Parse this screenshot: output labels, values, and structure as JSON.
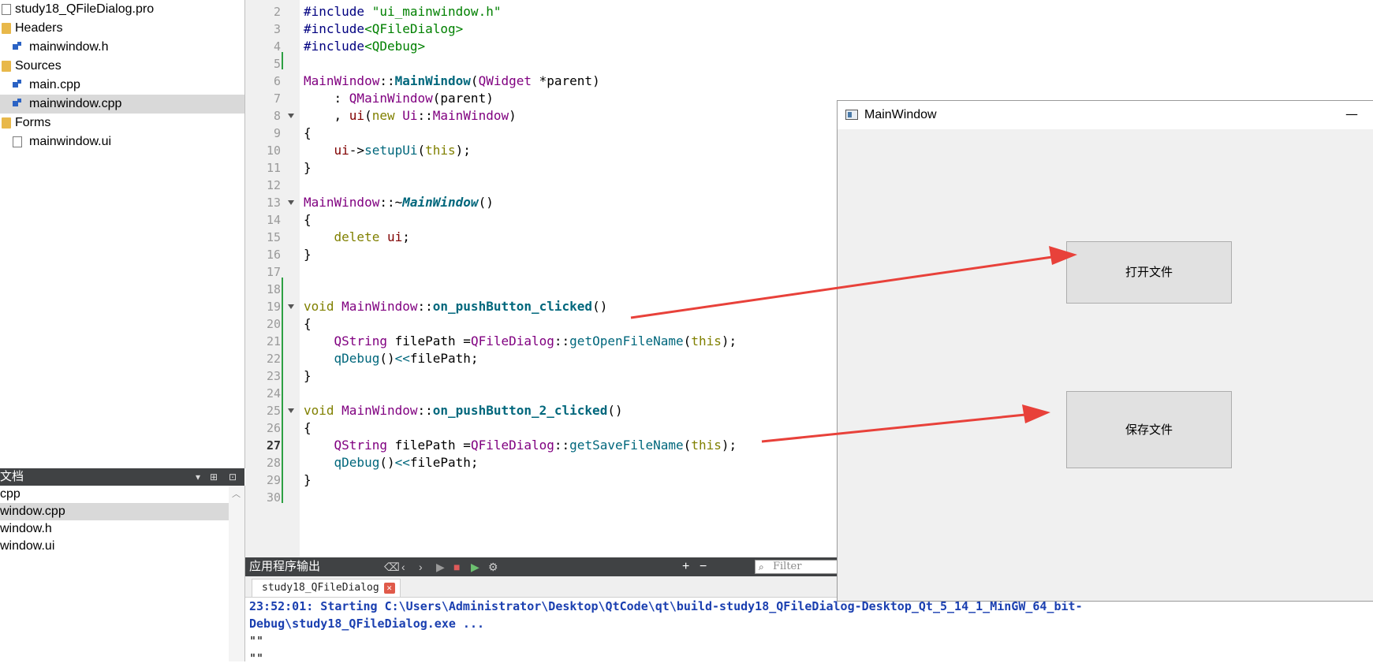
{
  "project_tree": [
    {
      "label": "study18_QFileDialog.pro",
      "indent": 0,
      "icon": "project-file-icon",
      "selected": false
    },
    {
      "label": "Headers",
      "indent": 0,
      "icon": "folder-icon",
      "selected": false
    },
    {
      "label": "mainwindow.h",
      "indent": 1,
      "icon": "header-file-icon",
      "selected": false
    },
    {
      "label": "Sources",
      "indent": 0,
      "icon": "folder-icon",
      "selected": false
    },
    {
      "label": "main.cpp",
      "indent": 1,
      "icon": "cpp-file-icon",
      "selected": false
    },
    {
      "label": "mainwindow.cpp",
      "indent": 1,
      "icon": "cpp-file-icon",
      "selected": true
    },
    {
      "label": "Forms",
      "indent": 0,
      "icon": "folder-icon",
      "selected": false
    },
    {
      "label": "mainwindow.ui",
      "indent": 1,
      "icon": "ui-file-icon",
      "selected": false
    }
  ],
  "open_docs": {
    "title": "文档",
    "items": [
      {
        "label": "cpp",
        "selected": false
      },
      {
        "label": "window.cpp",
        "selected": true
      },
      {
        "label": "window.h",
        "selected": false
      },
      {
        "label": "window.ui",
        "selected": false
      }
    ]
  },
  "editor": {
    "current_line": 27,
    "lines": [
      {
        "n": 2,
        "seg": [
          [
            "#include ",
            "pre"
          ],
          [
            "\"ui_mainwindow.h\"",
            "str"
          ]
        ]
      },
      {
        "n": 3,
        "seg": [
          [
            "#include",
            "pre"
          ],
          [
            "<QFileDialog>",
            "str"
          ]
        ]
      },
      {
        "n": 4,
        "seg": [
          [
            "#include",
            "pre"
          ],
          [
            "<QDebug>",
            "str"
          ]
        ]
      },
      {
        "n": 5,
        "seg": []
      },
      {
        "n": 6,
        "seg": [
          [
            "MainWindow",
            "type"
          ],
          [
            "::",
            "op"
          ],
          [
            "MainWindow",
            "fn"
          ],
          [
            "(",
            "op"
          ],
          [
            "QWidget",
            "type"
          ],
          [
            " *parent)",
            "op"
          ]
        ]
      },
      {
        "n": 7,
        "seg": [
          [
            "    : ",
            "op"
          ],
          [
            "QMainWindow",
            "type"
          ],
          [
            "(parent)",
            "op"
          ]
        ]
      },
      {
        "n": 8,
        "seg": [
          [
            "    , ",
            "op"
          ],
          [
            "ui",
            "var"
          ],
          [
            "(",
            "op"
          ],
          [
            "new",
            "kw"
          ],
          [
            " ",
            "op"
          ],
          [
            "Ui",
            "type"
          ],
          [
            "::",
            "op"
          ],
          [
            "MainWindow",
            "type"
          ],
          [
            ")",
            "op"
          ]
        ]
      },
      {
        "n": 9,
        "seg": [
          [
            "{",
            "op"
          ]
        ]
      },
      {
        "n": 10,
        "seg": [
          [
            "    ",
            "op"
          ],
          [
            "ui",
            "var"
          ],
          [
            "->",
            "op"
          ],
          [
            "setupUi",
            "call"
          ],
          [
            "(",
            "op"
          ],
          [
            "this",
            "kw"
          ],
          [
            ");",
            "op"
          ]
        ]
      },
      {
        "n": 11,
        "seg": [
          [
            "}",
            "op"
          ]
        ]
      },
      {
        "n": 12,
        "seg": []
      },
      {
        "n": 13,
        "seg": [
          [
            "MainWindow",
            "type"
          ],
          [
            "::~",
            "op"
          ],
          [
            "MainWindow",
            "fni"
          ],
          [
            "()",
            "op"
          ]
        ]
      },
      {
        "n": 14,
        "seg": [
          [
            "{",
            "op"
          ]
        ]
      },
      {
        "n": 15,
        "seg": [
          [
            "    ",
            "op"
          ],
          [
            "delete",
            "kw"
          ],
          [
            " ",
            "op"
          ],
          [
            "ui",
            "var"
          ],
          [
            ";",
            "op"
          ]
        ]
      },
      {
        "n": 16,
        "seg": [
          [
            "}",
            "op"
          ]
        ]
      },
      {
        "n": 17,
        "seg": []
      },
      {
        "n": 18,
        "seg": []
      },
      {
        "n": 19,
        "seg": [
          [
            "void",
            "kw"
          ],
          [
            " ",
            "op"
          ],
          [
            "MainWindow",
            "type"
          ],
          [
            "::",
            "op"
          ],
          [
            "on_pushButton_clicked",
            "fn"
          ],
          [
            "()",
            "op"
          ]
        ]
      },
      {
        "n": 20,
        "seg": [
          [
            "{",
            "op"
          ]
        ]
      },
      {
        "n": 21,
        "seg": [
          [
            "    ",
            "op"
          ],
          [
            "QString",
            "type"
          ],
          [
            " filePath =",
            "op"
          ],
          [
            "QFileDialog",
            "type"
          ],
          [
            "::",
            "op"
          ],
          [
            "getOpenFileName",
            "call"
          ],
          [
            "(",
            "op"
          ],
          [
            "this",
            "kw"
          ],
          [
            ");",
            "op"
          ]
        ]
      },
      {
        "n": 22,
        "seg": [
          [
            "    ",
            "op"
          ],
          [
            "qDebug",
            "call"
          ],
          [
            "()",
            "op"
          ],
          [
            "<<",
            "call"
          ],
          [
            "filePath;",
            "op"
          ]
        ]
      },
      {
        "n": 23,
        "seg": [
          [
            "}",
            "op"
          ]
        ]
      },
      {
        "n": 24,
        "seg": []
      },
      {
        "n": 25,
        "seg": [
          [
            "void",
            "kw"
          ],
          [
            " ",
            "op"
          ],
          [
            "MainWindow",
            "type"
          ],
          [
            "::",
            "op"
          ],
          [
            "on_pushButton_2_clicked",
            "fn"
          ],
          [
            "()",
            "op"
          ]
        ]
      },
      {
        "n": 26,
        "seg": [
          [
            "{",
            "op"
          ]
        ]
      },
      {
        "n": 27,
        "seg": [
          [
            "    ",
            "op"
          ],
          [
            "QString",
            "type"
          ],
          [
            " filePath =",
            "op"
          ],
          [
            "QFileDialog",
            "type"
          ],
          [
            "::",
            "op"
          ],
          [
            "getSaveFileName",
            "call"
          ],
          [
            "(",
            "op"
          ],
          [
            "this",
            "kw"
          ],
          [
            ");",
            "op"
          ]
        ]
      },
      {
        "n": 28,
        "seg": [
          [
            "    ",
            "op"
          ],
          [
            "qDebug",
            "call"
          ],
          [
            "()",
            "op"
          ],
          [
            "<<",
            "call"
          ],
          [
            "filePath;",
            "op"
          ]
        ]
      },
      {
        "n": 29,
        "seg": [
          [
            "}",
            "op"
          ]
        ]
      },
      {
        "n": 30,
        "seg": []
      }
    ],
    "fold_lines": [
      8,
      13,
      19,
      25
    ]
  },
  "output": {
    "title": "应用程序输出",
    "filter_placeholder": "Filter",
    "tab_label": "study18_QFileDialog",
    "lines": [
      {
        "text": "23:52:01: Starting C:\\Users\\Administrator\\Desktop\\QtCode\\qt\\build-study18_QFileDialog-Desktop_Qt_5_14_1_MinGW_64_bit-",
        "style": "blue"
      },
      {
        "text": "Debug\\study18_QFileDialog.exe ...",
        "style": "blue"
      },
      {
        "text": "\"\"",
        "style": "plain"
      },
      {
        "text": "\"\"",
        "style": "plain"
      }
    ]
  },
  "main_window": {
    "title": "MainWindow",
    "open_button": "打开文件",
    "save_button": "保存文件"
  },
  "colors": {
    "annotation_arrow": "#e8413a"
  }
}
